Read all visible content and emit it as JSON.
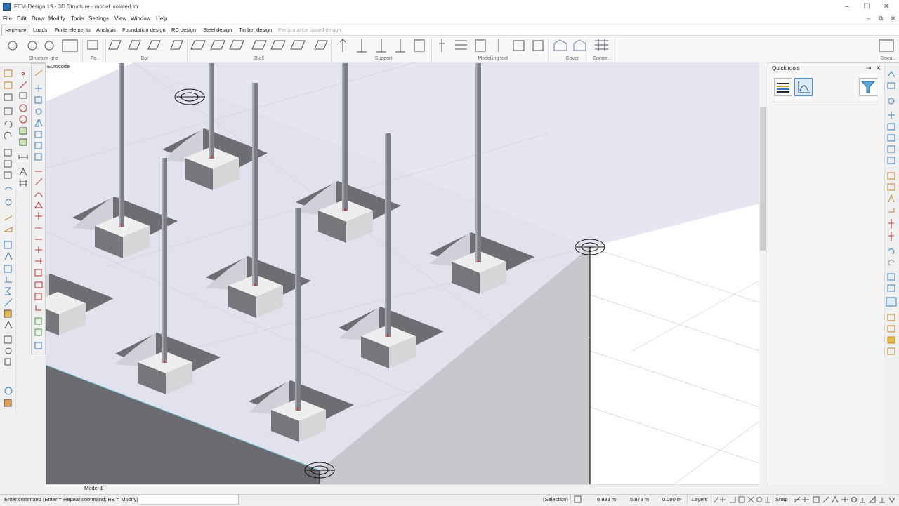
{
  "window": {
    "title": "FEM-Design 19 - 3D Structure - model isolated.str",
    "minimize": "–",
    "maximize": "☐",
    "close": "✕",
    "mdi_minimize": "–",
    "mdi_restore": "⧉",
    "mdi_close": "✕"
  },
  "menu": [
    "File",
    "Edit",
    "Draw",
    "Modify",
    "Tools",
    "Settings",
    "View",
    "Window",
    "Help"
  ],
  "ribbon_tabs": [
    "Structure",
    "Loads",
    "Finite elements",
    "Analysis",
    "Foundation design",
    "RC design",
    "Steel design",
    "Timber design",
    "Performance based design"
  ],
  "ribbon_groups": [
    "Structure grid",
    "Fo...",
    "Bar",
    "Shell",
    "Support",
    "Modelling tool",
    "Cover",
    "Constr...",
    "Docu..."
  ],
  "viewport": {
    "code_label": "Eurocode",
    "model_tab": "Model 1"
  },
  "quick_tools": {
    "title": "Quick tools",
    "pin": "⇥",
    "close": "✕"
  },
  "status": {
    "command_prompt": "Enter command (Enter = Repeat command; RB = Modify):",
    "mode": "(Selection)",
    "x": "6.989 m",
    "y": "5.879 m",
    "z": "0.000 m",
    "layers": "Layers",
    "snap": "Snap"
  },
  "colors": {
    "slab_top": "#e2e2ee",
    "slab_side": "#c6c6cc",
    "slab_front": "#6b6b6f",
    "shadow": "#6e6e72",
    "column": "#7b8088"
  }
}
